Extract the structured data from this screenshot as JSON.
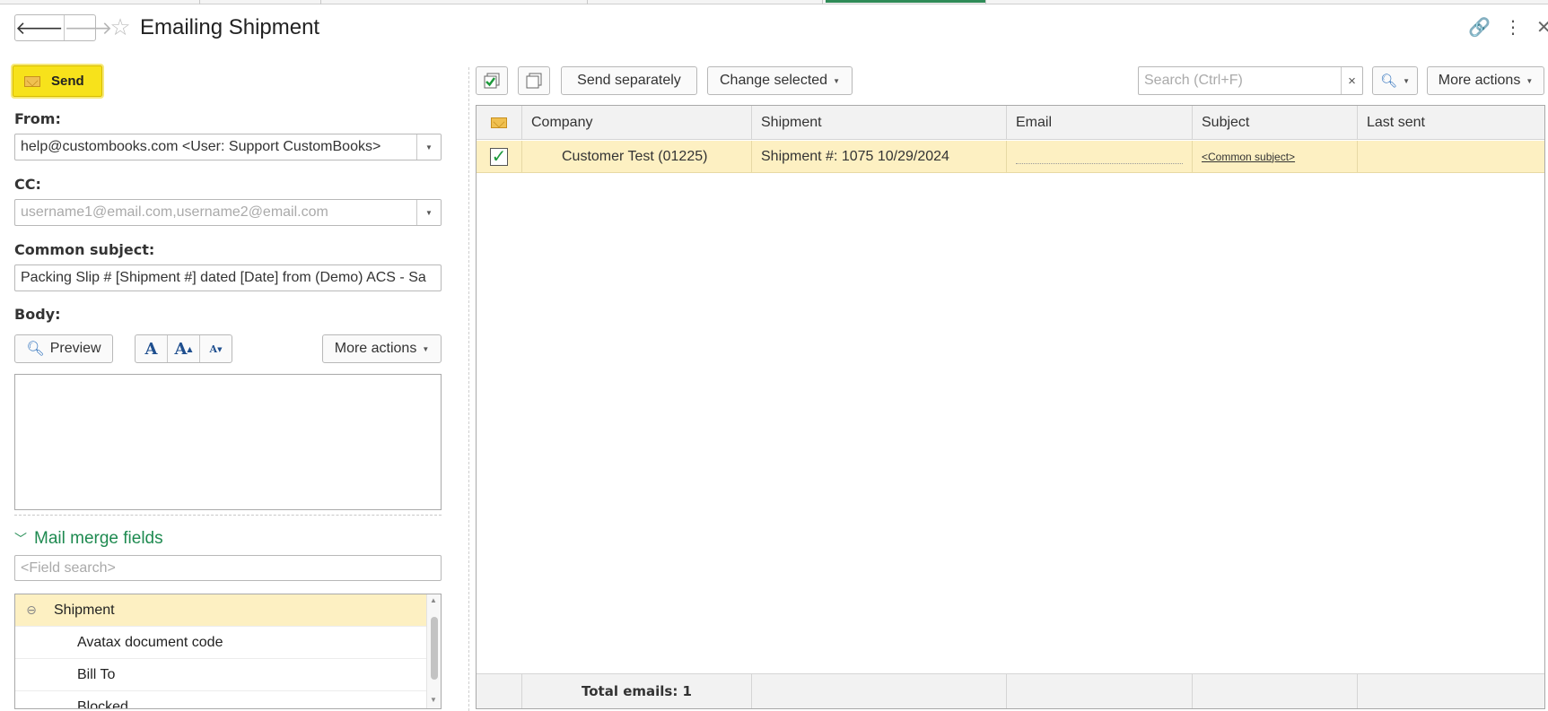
{
  "window": {
    "title": "Emailing Shipment",
    "back_glyph": "🡐",
    "forward_glyph": "🡒",
    "star_glyph": "☆",
    "link_glyph": "🔗",
    "menu_glyph": "⋮",
    "close_glyph": "✕"
  },
  "left": {
    "send_label": "Send",
    "from_label": "From:",
    "from_value": "help@custombooks.com <User: Support CustomBooks>",
    "cc_label": "CC:",
    "cc_placeholder": "username1@email.com,username2@email.com",
    "subject_label": "Common subject:",
    "subject_value": "Packing Slip # [Shipment #] dated [Date] from (Demo) ACS - Sa",
    "body_label": "Body:",
    "preview_label": "Preview",
    "font_buttons": [
      "A",
      "A",
      "A"
    ],
    "more_actions_label": "More actions",
    "mail_merge_label": "Mail merge fields",
    "field_search_placeholder": "<Field search>",
    "tree": {
      "group": "Shipment",
      "group_toggle": "⊖",
      "items": [
        "Avatax document code",
        "Bill To",
        "Blocked"
      ]
    }
  },
  "right": {
    "toolbar": {
      "send_separately_label": "Send separately",
      "change_selected_label": "Change selected",
      "search_placeholder": "Search (Ctrl+F)",
      "clear_glyph": "×",
      "more_actions_label": "More actions"
    },
    "table": {
      "columns": [
        "Company",
        "Shipment",
        "Email",
        "Subject",
        "Last sent"
      ],
      "rows": [
        {
          "checked": "✓",
          "company": "Customer Test (01225)",
          "shipment": "Shipment #: 1075 10/29/2024",
          "email": "",
          "subject": "<Common subject>",
          "last_sent": ""
        }
      ],
      "footer_total": "Total emails: 1"
    }
  },
  "colors": {
    "accent_yellow": "#f7e21b",
    "selected_row": "#fdf0c2",
    "green_text": "#1e8a50"
  }
}
